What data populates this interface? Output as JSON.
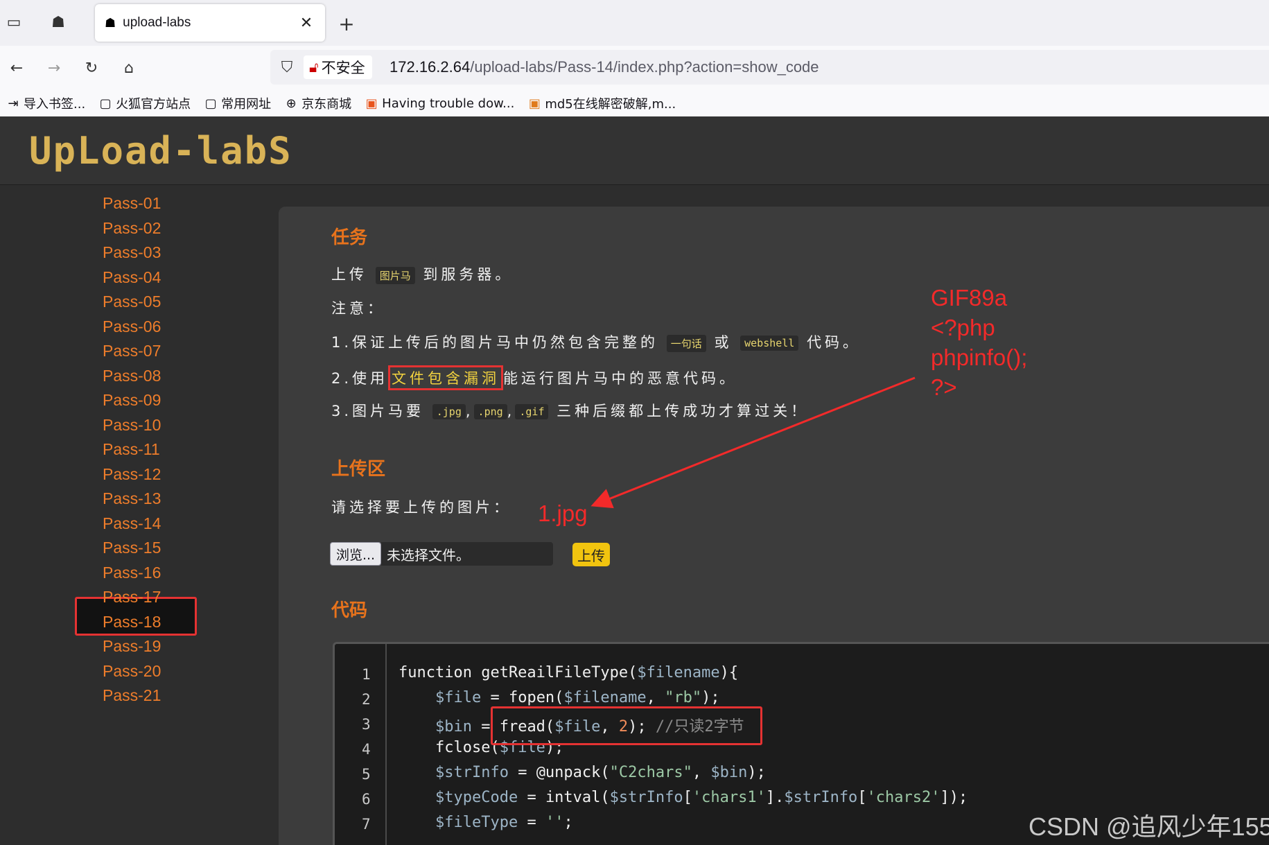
{
  "browser": {
    "tab_title": "upload-labs",
    "insecure_label": "不安全",
    "url_host": "172.16.2.64",
    "url_path": "/upload-labs/Pass-14/index.php?action=show_code"
  },
  "bookmarks": [
    {
      "label": "导入书签...",
      "icon": "import-icon"
    },
    {
      "label": "火狐官方站点",
      "icon": "folder-icon"
    },
    {
      "label": "常用网址",
      "icon": "folder-icon"
    },
    {
      "label": "京东商城",
      "icon": "globe-icon"
    },
    {
      "label": "Having trouble dow...",
      "icon": "site-icon"
    },
    {
      "label": "md5在线解密破解,m...",
      "icon": "site-icon"
    }
  ],
  "logo_text": "UpLoad-labS",
  "sidebar": {
    "items": [
      "Pass-01",
      "Pass-02",
      "Pass-03",
      "Pass-04",
      "Pass-05",
      "Pass-06",
      "Pass-07",
      "Pass-08",
      "Pass-09",
      "Pass-10",
      "Pass-11",
      "Pass-12",
      "Pass-13",
      "Pass-14",
      "Pass-15",
      "Pass-16",
      "Pass-17",
      "Pass-18",
      "Pass-19",
      "Pass-20",
      "Pass-21"
    ],
    "active": "Pass-14"
  },
  "task": {
    "heading": "任务",
    "line1_a": "上传",
    "line1_chip": "图片马",
    "line1_b": "到服务器。",
    "note": "注意：",
    "item1_a": "1.保证上传后的图片马中仍然包含完整的",
    "item1_chip1": "一句话",
    "item1_mid": "或",
    "item1_chip2": "webshell",
    "item1_b": "代码。",
    "item2_a": "2.使用",
    "item2_hl": "文件包含漏洞",
    "item2_b": "能运行图片马中的恶意代码。",
    "item3_a": "3.图片马要",
    "item3_chip1": ".jpg",
    "item3_sep1": ",",
    "item3_chip2": ".png",
    "item3_sep2": ",",
    "item3_chip3": ".gif",
    "item3_b": "三种后缀都上传成功才算过关！"
  },
  "upload": {
    "heading": "上传区",
    "prompt": "请选择要上传的图片：",
    "browse_label": "浏览...",
    "no_file_label": "未选择文件。",
    "submit_label": "上传"
  },
  "code": {
    "heading": "代码",
    "line_numbers": [
      "1",
      "2",
      "3",
      "4",
      "5",
      "6",
      "7"
    ]
  },
  "annotations": {
    "payload": [
      "GIF89a",
      "<?php",
      "phpinfo();",
      "?>"
    ],
    "filename": "1.jpg"
  },
  "watermark": "CSDN @追风少年155",
  "colors": {
    "accent_orange": "#e8731c",
    "sidebar_link": "#ee7d2b",
    "annotation_red": "#f32a2a",
    "upload_button": "#f1c40f"
  }
}
